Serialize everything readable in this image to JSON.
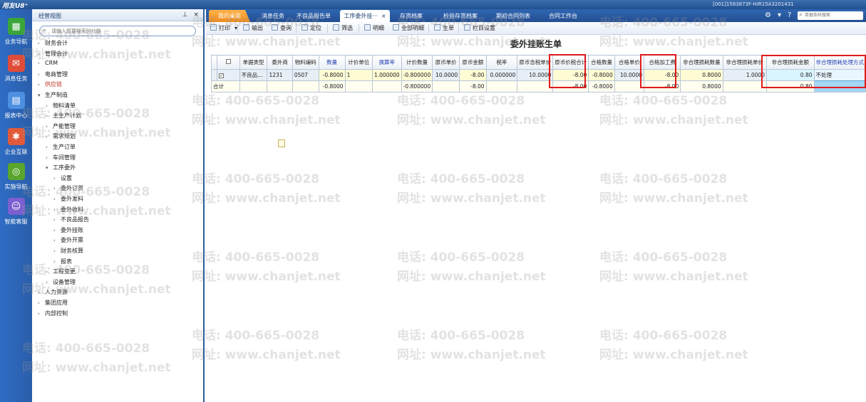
{
  "titlebar": {
    "logo": "用友U8⁺",
    "userinfo": "[001]1583873F-HIR15A3201431"
  },
  "leftnav": [
    {
      "label": "业务导航",
      "icon": "business-nav-icon",
      "color": "#3aa53a",
      "glyph": "▦"
    },
    {
      "label": "消息任务",
      "icon": "message-icon",
      "color": "#e04c3a",
      "glyph": "✉"
    },
    {
      "label": "报表中心",
      "icon": "report-icon",
      "color": "#4d8fe0",
      "glyph": "▤"
    },
    {
      "label": "企业互联",
      "icon": "enterprise-connect-icon",
      "color": "#e05a3a",
      "glyph": "✱"
    },
    {
      "label": "实施导航",
      "icon": "implementation-nav-icon",
      "color": "#5aa52c",
      "glyph": "◎"
    },
    {
      "label": "智能客服",
      "icon": "smart-service-icon",
      "color": "#7b5fd0",
      "glyph": "☺"
    }
  ],
  "tree": {
    "title": "经营视图",
    "search_placeholder": "请输入您要搜索的功能",
    "items": [
      {
        "label": "财务会计",
        "level": 1,
        "expanded": false
      },
      {
        "label": "管理会计",
        "level": 1,
        "expanded": false
      },
      {
        "label": "CRM",
        "level": 1,
        "expanded": false
      },
      {
        "label": "电商管理",
        "level": 1,
        "expanded": false
      },
      {
        "label": "供应链",
        "level": 1,
        "expanded": false,
        "highlight": true
      },
      {
        "label": "生产制造",
        "level": 1,
        "expanded": true
      },
      {
        "label": "物料清单",
        "level": 2,
        "expanded": false
      },
      {
        "label": "主生产计划",
        "level": 2,
        "expanded": false
      },
      {
        "label": "产能管理",
        "level": 2,
        "expanded": false
      },
      {
        "label": "需求规划",
        "level": 2,
        "expanded": false
      },
      {
        "label": "生产订单",
        "level": 2,
        "expanded": false
      },
      {
        "label": "车间管理",
        "level": 2,
        "expanded": false
      },
      {
        "label": "工序委外",
        "level": 2,
        "expanded": true
      },
      {
        "label": "设置",
        "level": 3,
        "expanded": false
      },
      {
        "label": "委外订货",
        "level": 3,
        "expanded": false
      },
      {
        "label": "委外发料",
        "level": 3,
        "expanded": false
      },
      {
        "label": "委外收料",
        "level": 3,
        "expanded": false
      },
      {
        "label": "不良品报告",
        "level": 3,
        "expanded": false
      },
      {
        "label": "委外挂账",
        "level": 3,
        "expanded": false
      },
      {
        "label": "委外开票",
        "level": 3,
        "expanded": false
      },
      {
        "label": "财务核算",
        "level": 3,
        "expanded": false
      },
      {
        "label": "报表",
        "level": 3,
        "expanded": false
      },
      {
        "label": "工程变更",
        "level": 2,
        "expanded": false
      },
      {
        "label": "设备管理",
        "level": 2,
        "expanded": false
      },
      {
        "label": "人力资源",
        "level": 1,
        "expanded": false
      },
      {
        "label": "集团应用",
        "level": 1,
        "expanded": false
      },
      {
        "label": "内部控制",
        "level": 1,
        "expanded": false
      }
    ]
  },
  "tabs": [
    {
      "label": "我的桌面",
      "kind": "home"
    },
    {
      "label": "消息任务",
      "kind": "normal"
    },
    {
      "label": "不良品报告单",
      "kind": "normal"
    },
    {
      "label": "工序委外挂···",
      "kind": "active",
      "close": "×"
    },
    {
      "label": "存货档案",
      "kind": "normal"
    },
    {
      "label": "检验存货档案",
      "kind": "normal"
    },
    {
      "label": "期初合同列表",
      "kind": "normal"
    },
    {
      "label": "合同工作台",
      "kind": "normal"
    }
  ],
  "topbar": {
    "search_placeholder": "单据条码搜索",
    "help": "?",
    "settings": "⚙",
    "menu": "▾"
  },
  "toolbar": [
    {
      "label": "打印",
      "icon": "print-icon",
      "dropdown": "▾"
    },
    {
      "label": "输出",
      "icon": "export-icon"
    },
    {
      "label": "查询",
      "icon": "query-icon"
    },
    {
      "label": "定位",
      "icon": "locate-icon"
    },
    {
      "label": "筛选",
      "icon": "filter-icon"
    },
    {
      "label": "明细",
      "icon": "detail-icon"
    },
    {
      "label": "全部明细",
      "icon": "all-detail-icon"
    },
    {
      "label": "生单",
      "icon": "generate-doc-icon"
    },
    {
      "label": "栏目设置",
      "icon": "column-settings-icon"
    }
  ],
  "document": {
    "title": "委外挂账生单",
    "columns": [
      "单据类型",
      "委外商",
      "物料编码",
      "数量",
      "计价单位",
      "换算率",
      "计价数量",
      "原币单价",
      "原币金额",
      "税率",
      "原币含税单价",
      "原币价税合计",
      "合格数量",
      "合格单价",
      "合格加工费",
      "非合理损耗数量",
      "非合理损耗单价",
      "非合理损耗金额",
      "非合理损耗处理方式"
    ],
    "rows": [
      [
        "不良品…",
        "1231",
        "0507",
        "-0.8000",
        "1",
        "1.000000",
        "-0.800000",
        "10.0000",
        "-8.00",
        "0.000000",
        "10.0000",
        "-8.00",
        "-0.8000",
        "10.0000",
        "-8.00",
        "0.8000",
        "1.0000",
        "0.80",
        "不处理"
      ]
    ],
    "totals": {
      "label": "合计",
      "cells": [
        "",
        "",
        "",
        "-0.8000",
        "",
        "",
        "-0.800000",
        "",
        "-8.00",
        "",
        "",
        "-8.00",
        "-0.8000",
        "",
        "-8.00",
        "0.8000",
        "",
        "0.80",
        ""
      ]
    }
  },
  "watermark": {
    "phone": "电话: 400-665-0028",
    "site": "网址: www.chanjet.net"
  }
}
